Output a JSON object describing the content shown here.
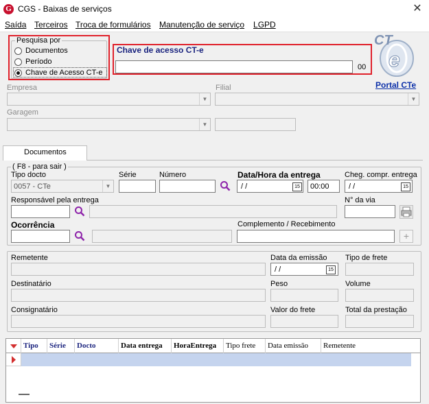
{
  "window": {
    "title": "CGS - Baixas de serviços",
    "close_glyph": "✕",
    "app_icon_letter": "G"
  },
  "menu": [
    {
      "first": "S",
      "rest": "aída"
    },
    {
      "first": "T",
      "rest": "erceiros"
    },
    {
      "first": "T",
      "rest": "roca de formulários"
    },
    {
      "first": "M",
      "rest": "anutenção de serviço"
    },
    {
      "first": "L",
      "rest": "GPD"
    }
  ],
  "search_by": {
    "title": "Pesquisa por",
    "options": [
      "Documentos",
      "Período",
      "Chave de Acesso CT-e"
    ],
    "selected_index": 2
  },
  "cte_key": {
    "label": "Chave de acesso CT-e",
    "value": "",
    "suffix": "00"
  },
  "logo": {
    "text": "CT",
    "sub": "e",
    "link": "Portal CTe"
  },
  "empresa": {
    "label": "Empresa",
    "value": ""
  },
  "filial": {
    "label": "Filial",
    "value": ""
  },
  "garagem": {
    "label": "Garagem",
    "value": ""
  },
  "tabs": {
    "documentos": "Documentos"
  },
  "doc_group": {
    "title": "( F8 - para sair )",
    "tipo_docto_label": "Tipo docto",
    "tipo_docto_value": "0057 - CTe",
    "serie_label": "Série",
    "numero_label": "Número",
    "data_hora_label": "Data/Hora da entrega",
    "data_value": " /  /",
    "hora_value": "00:00",
    "cheg_label": "Cheg. compr. entrega",
    "cheg_value": " /  /",
    "cal_glyph": "15",
    "responsavel_label": "Responsável pela entrega",
    "via_label": "N° da via",
    "ocorrencia_label": "Ocorrência",
    "complemento_label": "Complemento / Recebimento",
    "plus_glyph": "+"
  },
  "details": {
    "remetente_label": "Remetente",
    "data_emissao_label": "Data da emissão",
    "data_emissao_value": " /  /",
    "tipo_frete_label": "Tipo de frete",
    "destinatario_label": "Destinatário",
    "peso_label": "Peso",
    "volume_label": "Volume",
    "consignatario_label": "Consignatário",
    "valor_frete_label": "Valor do frete",
    "total_prestacao_label": "Total da prestação"
  },
  "grid": {
    "columns": [
      "Tipo",
      "Série",
      "Docto",
      "Data entrega",
      "HoraEntrega",
      "Tipo frete",
      "Data emissão",
      "Remetente"
    ],
    "colors": {
      "header_blue": "#1a237e",
      "selected_row": "#c5d4ee",
      "marker_red": "#d32f2f"
    }
  },
  "colors": {
    "red_highlight": "#e0202a",
    "link_blue": "#0b2fa8",
    "label_navy": "#1a237e"
  }
}
